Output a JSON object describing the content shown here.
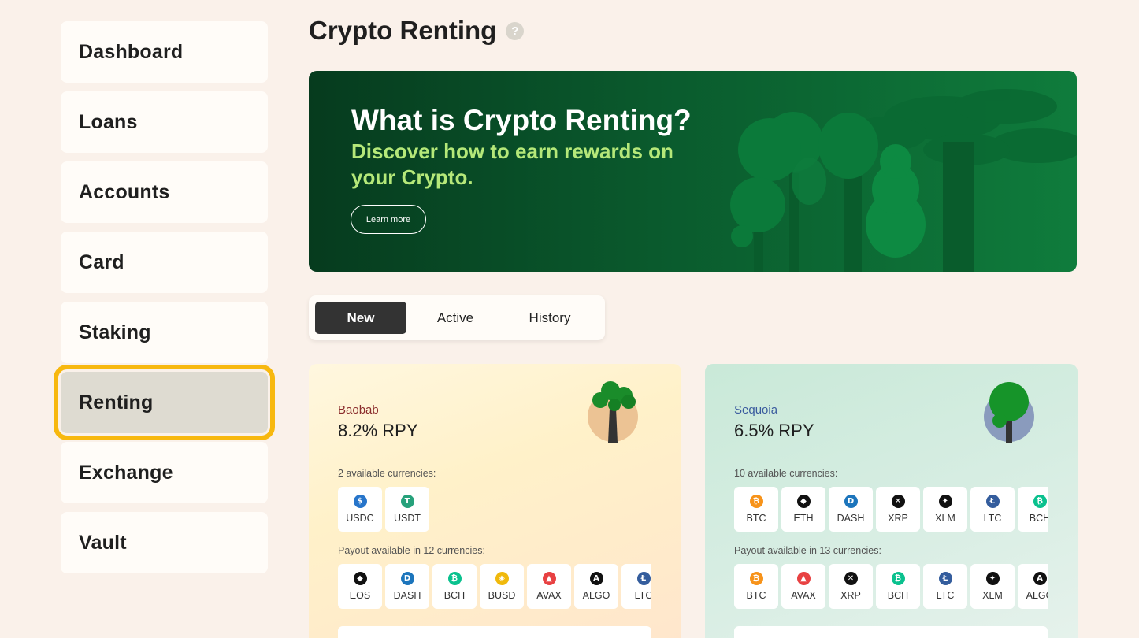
{
  "sidebar": {
    "items": [
      {
        "label": "Dashboard"
      },
      {
        "label": "Loans"
      },
      {
        "label": "Accounts"
      },
      {
        "label": "Card"
      },
      {
        "label": "Staking"
      },
      {
        "label": "Renting",
        "active": true
      },
      {
        "label": "Exchange"
      },
      {
        "label": "Vault"
      }
    ]
  },
  "header": {
    "title": "Crypto Renting",
    "help_icon": "?"
  },
  "banner": {
    "title": "What is Crypto Renting?",
    "subtitle": "Discover how to earn rewards on your Crypto.",
    "button": "Learn more"
  },
  "tabs": [
    {
      "label": "New",
      "selected": true
    },
    {
      "label": "Active"
    },
    {
      "label": "History"
    }
  ],
  "cards": [
    {
      "name": "Baobab",
      "rate": "8.2% RPY",
      "available_label": "2 available currencies:",
      "available": [
        {
          "sym": "USDC",
          "color": "#2775ca",
          "icon": "$"
        },
        {
          "sym": "USDT",
          "color": "#26a17b",
          "icon": "T"
        }
      ],
      "payout_label": "Payout available in 12 currencies:",
      "payout": [
        {
          "sym": "EOS",
          "color": "#111111",
          "icon": "◆"
        },
        {
          "sym": "DASH",
          "color": "#1c75bc",
          "icon": "D"
        },
        {
          "sym": "BCH",
          "color": "#0ac18e",
          "icon": "₿"
        },
        {
          "sym": "BUSD",
          "color": "#f0b90b",
          "icon": "◈"
        },
        {
          "sym": "AVAX",
          "color": "#e84142",
          "icon": "▲"
        },
        {
          "sym": "ALGO",
          "color": "#111111",
          "icon": "A"
        },
        {
          "sym": "LTC",
          "color": "#345d9d",
          "icon": "Ł"
        }
      ]
    },
    {
      "name": "Sequoia",
      "rate": "6.5% RPY",
      "available_label": "10 available currencies:",
      "available": [
        {
          "sym": "BTC",
          "color": "#f7931a",
          "icon": "₿"
        },
        {
          "sym": "ETH",
          "color": "#111111",
          "icon": "◆"
        },
        {
          "sym": "DASH",
          "color": "#1c75bc",
          "icon": "D"
        },
        {
          "sym": "XRP",
          "color": "#111111",
          "icon": "✕"
        },
        {
          "sym": "XLM",
          "color": "#111111",
          "icon": "✦"
        },
        {
          "sym": "LTC",
          "color": "#345d9d",
          "icon": "Ł"
        },
        {
          "sym": "BCH",
          "color": "#0ac18e",
          "icon": "₿"
        }
      ],
      "payout_label": "Payout available in 13 currencies:",
      "payout": [
        {
          "sym": "BTC",
          "color": "#f7931a",
          "icon": "₿"
        },
        {
          "sym": "AVAX",
          "color": "#e84142",
          "icon": "▲"
        },
        {
          "sym": "XRP",
          "color": "#111111",
          "icon": "✕"
        },
        {
          "sym": "BCH",
          "color": "#0ac18e",
          "icon": "₿"
        },
        {
          "sym": "LTC",
          "color": "#345d9d",
          "icon": "Ł"
        },
        {
          "sym": "XLM",
          "color": "#111111",
          "icon": "✦"
        },
        {
          "sym": "ALGO",
          "color": "#111111",
          "icon": "A"
        }
      ]
    }
  ]
}
